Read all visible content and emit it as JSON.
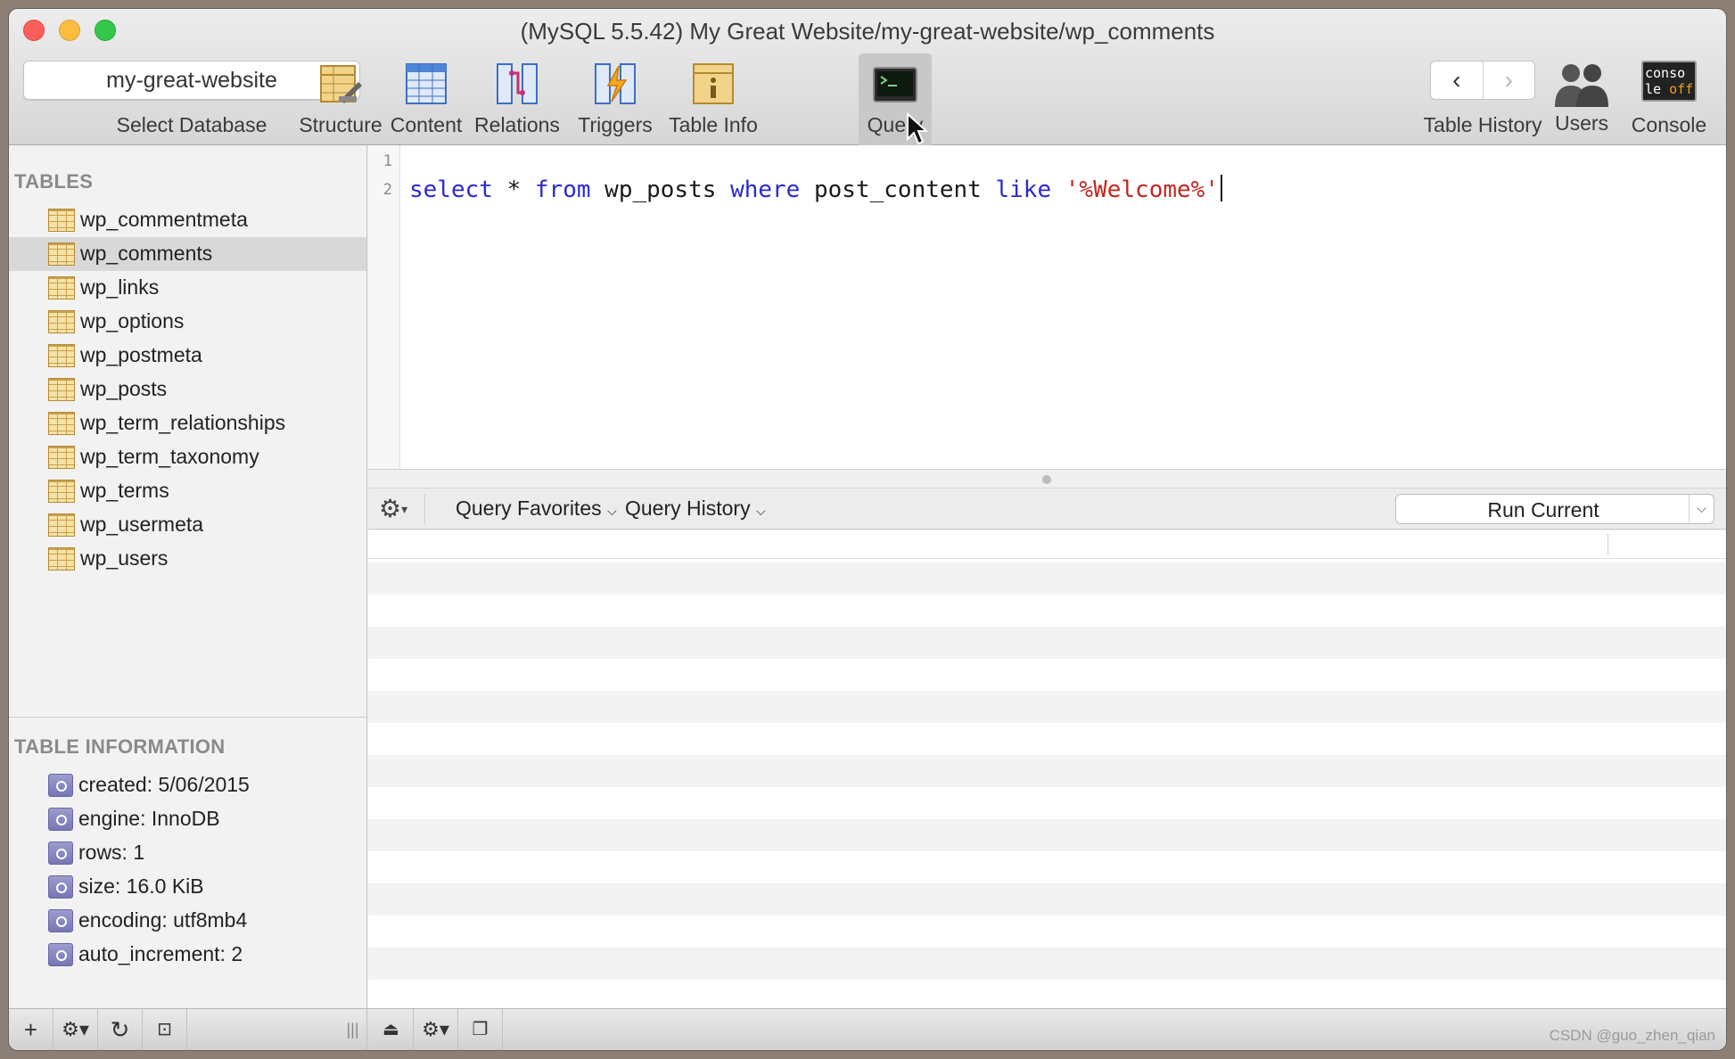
{
  "window": {
    "title": "(MySQL 5.5.42) My Great Website/my-great-website/wp_comments"
  },
  "toolbar": {
    "database_value": "my-great-website",
    "database_label": "Select Database",
    "buttons": [
      {
        "label": "Structure",
        "icon": "structure-icon"
      },
      {
        "label": "Content",
        "icon": "content-icon"
      },
      {
        "label": "Relations",
        "icon": "relations-icon"
      },
      {
        "label": "Triggers",
        "icon": "triggers-icon"
      },
      {
        "label": "Table Info",
        "icon": "table-info-icon"
      },
      {
        "label": "Query",
        "icon": "query-terminal-icon",
        "active": true
      }
    ],
    "history_label": "Table History",
    "users_label": "Users",
    "console_label": "Console",
    "console_icon_text": "conso\nle off"
  },
  "sidebar": {
    "tables_title": "TABLES",
    "tables": [
      "wp_commentmeta",
      "wp_comments",
      "wp_links",
      "wp_options",
      "wp_postmeta",
      "wp_posts",
      "wp_term_relationships",
      "wp_term_taxonomy",
      "wp_terms",
      "wp_usermeta",
      "wp_users"
    ],
    "selected_table": "wp_comments",
    "info_title": "TABLE INFORMATION",
    "info": [
      "created: 5/06/2015",
      "engine: InnoDB",
      "rows: 1",
      "size: 16.0 KiB",
      "encoding: utf8mb4",
      "auto_increment: 2"
    ]
  },
  "editor": {
    "line_numbers": [
      "1",
      "2"
    ],
    "query_tokens": [
      {
        "t": "select",
        "c": "kw"
      },
      {
        "t": " * ",
        "c": ""
      },
      {
        "t": "from",
        "c": "kw"
      },
      {
        "t": " wp_posts ",
        "c": ""
      },
      {
        "t": "where",
        "c": "kw"
      },
      {
        "t": " post_content ",
        "c": ""
      },
      {
        "t": "like",
        "c": "kw"
      },
      {
        "t": " ",
        "c": ""
      },
      {
        "t": "'%Welcome%'",
        "c": "str"
      }
    ]
  },
  "querybar": {
    "favorites_label": "Query Favorites",
    "history_label": "Query History",
    "run_label": "Run Current"
  },
  "watermark": "CSDN @guo_zhen_qian",
  "colors": {
    "keyword": "#2a2ad0",
    "string": "#c2271f",
    "selection": "#d8d8d8"
  }
}
